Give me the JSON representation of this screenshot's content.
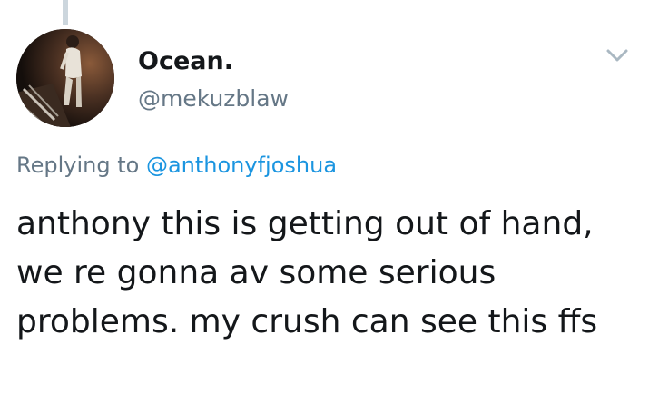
{
  "tweet": {
    "author": {
      "display_name": "Ocean.",
      "handle": "@mekuzblaw"
    },
    "replying_to": {
      "prefix": "Replying to",
      "handle": "@anthonyfjoshua"
    },
    "text": "anthony this is getting out of hand, we re gonna av some serious problems. my crush can see this ffs"
  },
  "icons": {
    "menu": "chevron-down-icon"
  },
  "colors": {
    "text": "#14171a",
    "secondary": "#657786",
    "link": "#1b95e0",
    "thread_line": "#ccd6dd"
  }
}
